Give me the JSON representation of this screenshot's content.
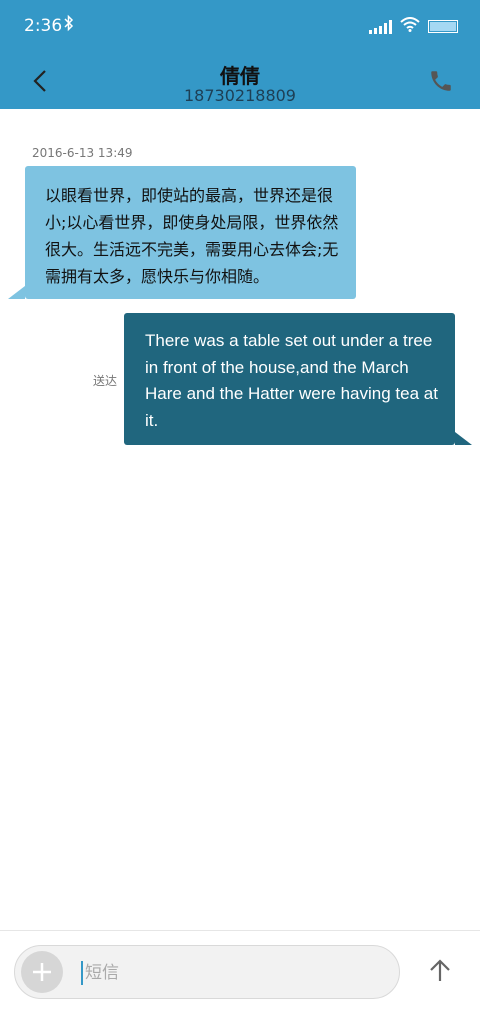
{
  "status_bar": {
    "time": "2:36",
    "bluetooth_icon": "bluetooth-icon",
    "signal_icon": "signal-icon",
    "wifi_icon": "wifi-icon",
    "battery_icon": "battery-icon"
  },
  "header": {
    "back_icon": "chevron-left-icon",
    "title": "倩倩",
    "subtitle": "18730218809",
    "call_icon": "phone-icon"
  },
  "thread": {
    "timestamp": "2016-6-13 13:49",
    "messages": [
      {
        "direction": "incoming",
        "text": "以眼看世界，即使站的最高，世界还是很小;以心看世界，即使身处局限，世界依然很大。生活远不完美，需要用心去体会;无需拥有太多，愿快乐与你相随。"
      },
      {
        "direction": "outgoing",
        "text": "There was a table set out under a tree in front of the house,and the March Hare and the Hatter were having tea at it.",
        "status": "送达"
      }
    ]
  },
  "composer": {
    "add_icon": "plus-icon",
    "placeholder": "短信",
    "value": "",
    "send_icon": "arrow-up-icon"
  },
  "colors": {
    "header": "#3498c7",
    "incoming_bubble": "#7ec3e1",
    "outgoing_bubble": "#20667e"
  }
}
